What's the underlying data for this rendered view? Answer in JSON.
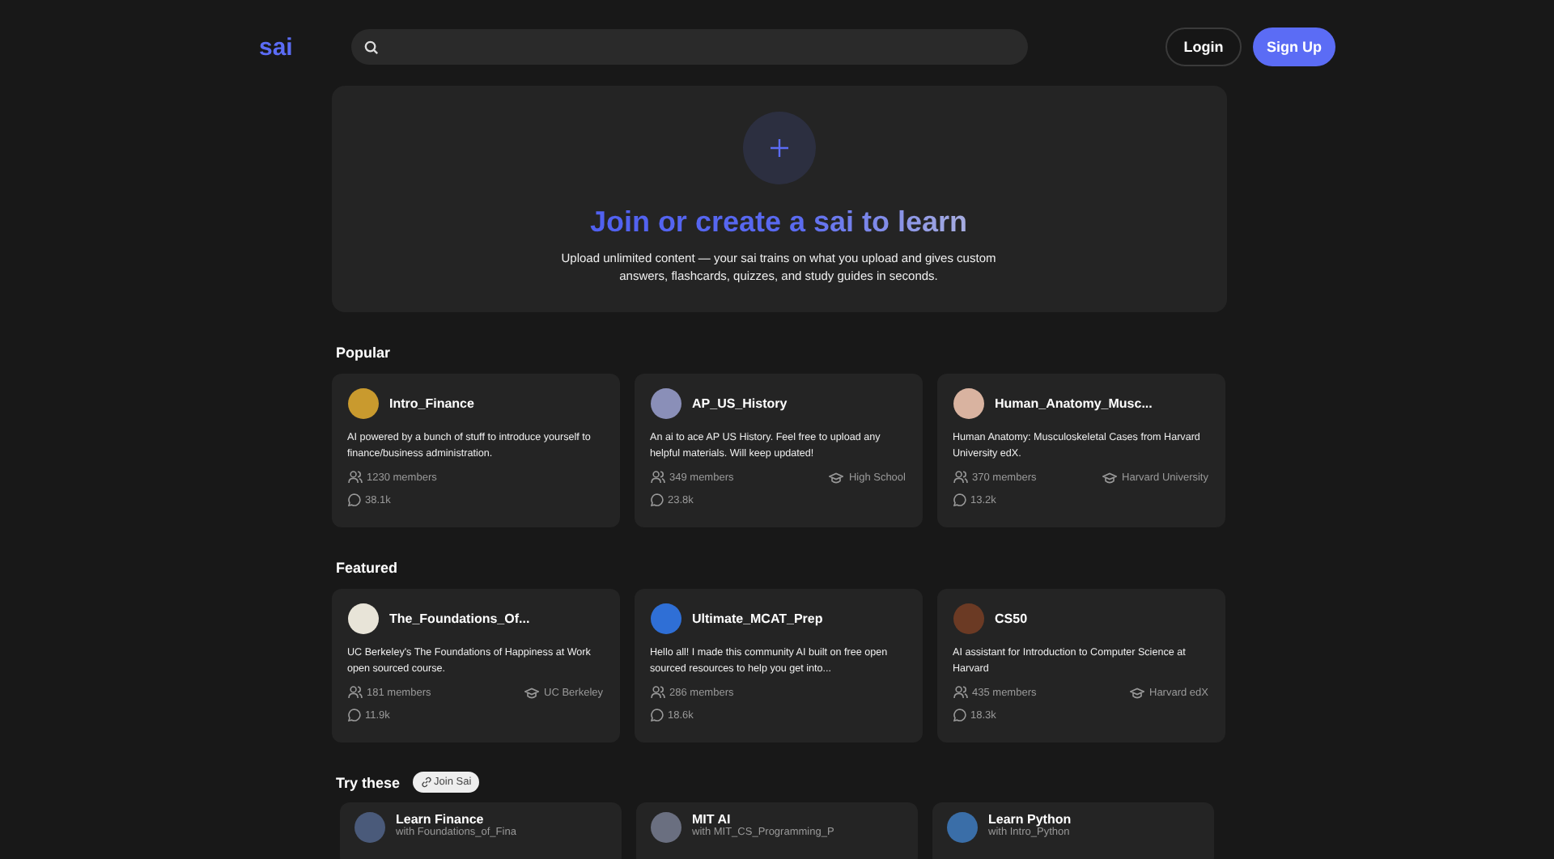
{
  "header": {
    "logo": "sai",
    "buttons": [
      {
        "label": "Login",
        "kind": "outline"
      },
      {
        "label": "Sign Up",
        "kind": "primary"
      }
    ]
  },
  "hero": {
    "title": "Join or create a sai to learn",
    "description": "Upload unlimited content — your sai trains on what you upload and gives custom answers, flashcards, quizzes, and study guides in seconds."
  },
  "sections": [
    {
      "title": "Popular",
      "cards": [
        {
          "name": "Intro_Finance",
          "description": "AI powered by a bunch of stuff to introduce yourself to finance/business administration.",
          "members": "1230 members",
          "messages": "38.1k",
          "color": "#c99a2e"
        },
        {
          "name": "AP_US_History",
          "description": "An ai to ace AP US History. Feel free to upload any helpful materials. Will keep updated!",
          "members": "349 members",
          "school": "High School",
          "messages": "23.8k",
          "color": "#8a8fb8"
        },
        {
          "name": "Human_Anatomy_Musc...",
          "description": "Human Anatomy: Musculoskeletal Cases from Harvard University edX.",
          "members": "370 members",
          "school": "Harvard University",
          "messages": "13.2k",
          "color": "#d9b3a0"
        }
      ]
    },
    {
      "title": "Featured",
      "cards": [
        {
          "name": "The_Foundations_Of...",
          "description": "UC Berkeley's The Foundations of Happiness at Work open sourced course.",
          "members": "181 members",
          "school": "UC Berkeley",
          "messages": "11.9k",
          "color": "#e8e4d8"
        },
        {
          "name": "Ultimate_MCAT_Prep",
          "description": "Hello all! I made this community AI built on free open sourced resources to help you get into...",
          "members": "286 members",
          "messages": "18.6k",
          "color": "#2f6fd6"
        },
        {
          "name": "CS50",
          "description": "AI assistant for Introduction to Computer Science at Harvard",
          "members": "435 members",
          "school": "Harvard edX",
          "messages": "18.3k",
          "color": "#6b3a24"
        }
      ]
    }
  ],
  "try_these": {
    "title": "Try these",
    "chip": "Join Sai",
    "cards": [
      {
        "name": "Learn Finance",
        "subtitle": "with Foundations_of_Fina",
        "color": "#4a5a7a"
      },
      {
        "name": "MIT AI",
        "subtitle": "with MIT_CS_Programming_P",
        "color": "#6a6f80"
      },
      {
        "name": "Learn Python",
        "subtitle": "with Intro_Python",
        "color": "#3a6ea8"
      }
    ]
  }
}
